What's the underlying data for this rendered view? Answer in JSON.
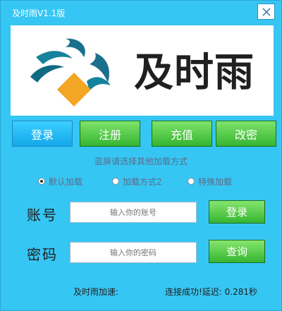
{
  "window": {
    "title": "及时雨V1.1版",
    "close_icon": "close-icon"
  },
  "banner": {
    "logo_text": "及时雨"
  },
  "tabs": [
    {
      "label": "登录",
      "active": true
    },
    {
      "label": "注册",
      "active": false
    },
    {
      "label": "充值",
      "active": false
    },
    {
      "label": "改密",
      "active": false
    }
  ],
  "hint": "蓝屏请选择其他加载方式",
  "load_options": [
    {
      "label": "默认加载",
      "checked": true
    },
    {
      "label": "加载方式2",
      "checked": false
    },
    {
      "label": "特殊加载",
      "checked": false
    }
  ],
  "form": {
    "account_label": "账号",
    "account_placeholder": "输入你的账号",
    "password_label": "密码",
    "password_placeholder": "输入你的密码",
    "login_button": "登录",
    "query_button": "查询"
  },
  "footer": {
    "left": "及时雨加速:",
    "status": "连接成功!延迟: 0.281秒"
  },
  "colors": {
    "window_bg": "#36c6f4",
    "green_button": "#35b532",
    "active_tab": "#13a7ea"
  }
}
